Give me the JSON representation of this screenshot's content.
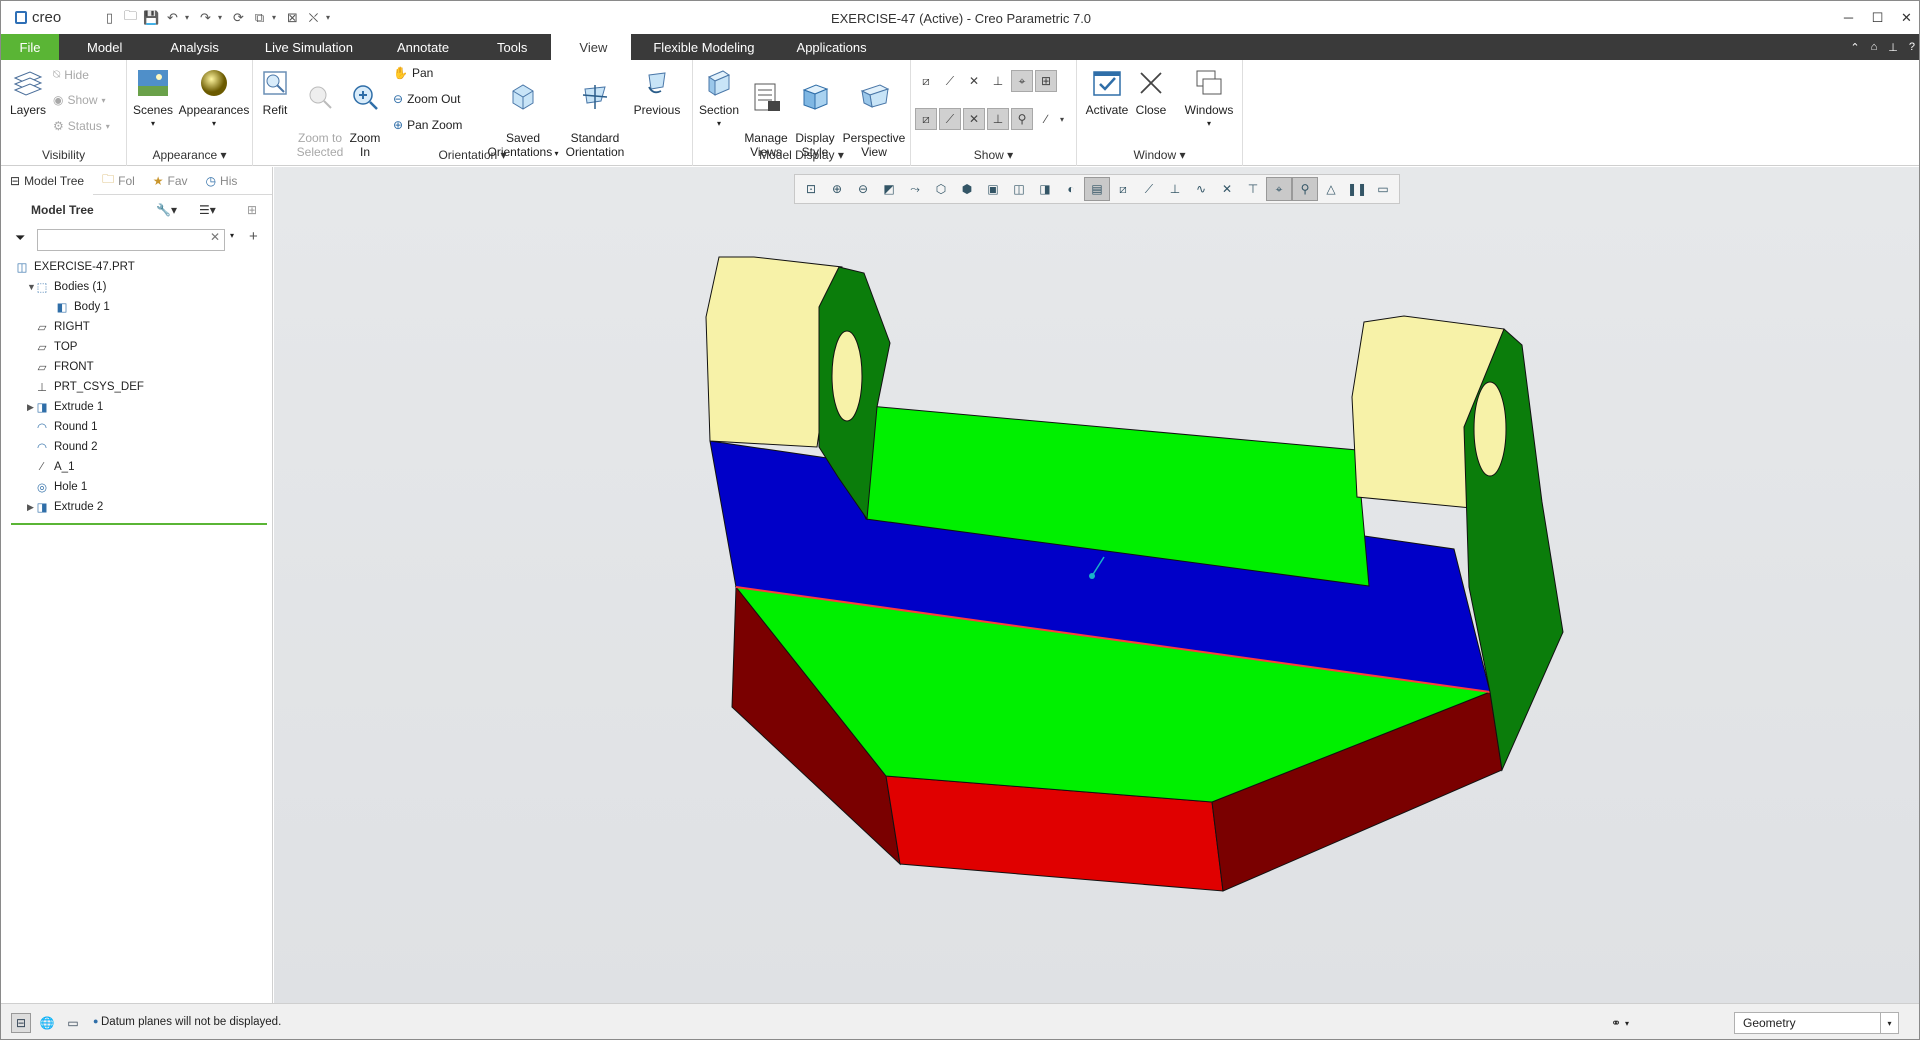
{
  "window": {
    "title": "EXERCISE-47 (Active) - Creo Parametric 7.0",
    "logo_text": "creo"
  },
  "menubar": {
    "tabs": [
      "File",
      "Model",
      "Analysis",
      "Live Simulation",
      "Annotate",
      "Tools",
      "View",
      "Flexible Modeling",
      "Applications"
    ],
    "active_tab": "View",
    "accent": "#5ab535"
  },
  "ribbon": {
    "visibility": {
      "layers": "Layers",
      "hide": "Hide",
      "show": "Show",
      "status": "Status",
      "label": "Visibility"
    },
    "appearance": {
      "scenes": "Scenes",
      "appearances": "Appearances",
      "label": "Appearance"
    },
    "orientation": {
      "refit": "Refit",
      "zoom_to_selected": "Zoom to\nSelected",
      "zoom_in": "Zoom\nIn",
      "pan": "Pan",
      "zoom_out": "Zoom Out",
      "pan_zoom": "Pan Zoom",
      "saved": "Saved\nOrientations",
      "standard": "Standard\nOrientation",
      "previous": "Previous",
      "label": "Orientation"
    },
    "model_display": {
      "section": "Section",
      "manage_views": "Manage\nViews",
      "display_style": "Display\nStyle",
      "perspective": "Perspective\nView",
      "label": "Model Display"
    },
    "show": {
      "label": "Show"
    },
    "window": {
      "activate": "Activate",
      "close": "Close",
      "windows": "Windows",
      "label": "Window"
    }
  },
  "left_panel": {
    "tabs": [
      "Model Tree",
      "Fol",
      "Fav",
      "His"
    ],
    "header": "Model Tree",
    "search_value": "",
    "tree": [
      {
        "label": "EXERCISE-47.PRT",
        "indent": 0,
        "expander": "",
        "icon": "part-icon"
      },
      {
        "label": "Bodies (1)",
        "indent": 1,
        "expander": "down",
        "icon": "bodies-icon"
      },
      {
        "label": "Body 1",
        "indent": 2,
        "expander": "",
        "icon": "body-icon"
      },
      {
        "label": "RIGHT",
        "indent": 1,
        "expander": "",
        "icon": "datum-plane-icon"
      },
      {
        "label": "TOP",
        "indent": 1,
        "expander": "",
        "icon": "datum-plane-icon"
      },
      {
        "label": "FRONT",
        "indent": 1,
        "expander": "",
        "icon": "datum-plane-icon"
      },
      {
        "label": "PRT_CSYS_DEF",
        "indent": 1,
        "expander": "",
        "icon": "csys-icon"
      },
      {
        "label": "Extrude 1",
        "indent": 1,
        "expander": "right",
        "icon": "extrude-icon"
      },
      {
        "label": "Round 1",
        "indent": 1,
        "expander": "",
        "icon": "round-icon"
      },
      {
        "label": "Round 2",
        "indent": 1,
        "expander": "",
        "icon": "round-icon"
      },
      {
        "label": "A_1",
        "indent": 1,
        "expander": "",
        "icon": "axis-icon"
      },
      {
        "label": "Hole 1",
        "indent": 1,
        "expander": "",
        "icon": "hole-icon"
      },
      {
        "label": "Extrude 2",
        "indent": 1,
        "expander": "right",
        "icon": "extrude-icon"
      }
    ]
  },
  "status_bar": {
    "message": "Datum planes will not be displayed.",
    "filter_value": "Geometry"
  },
  "model_colors": {
    "lug_cylinder": "#f7f2a8",
    "lug_face": "#0b7d0b",
    "top_face": "#00f000",
    "blue_face": "#0000c8",
    "red_face": "#e00000",
    "dark_red_face": "#7a0000"
  }
}
